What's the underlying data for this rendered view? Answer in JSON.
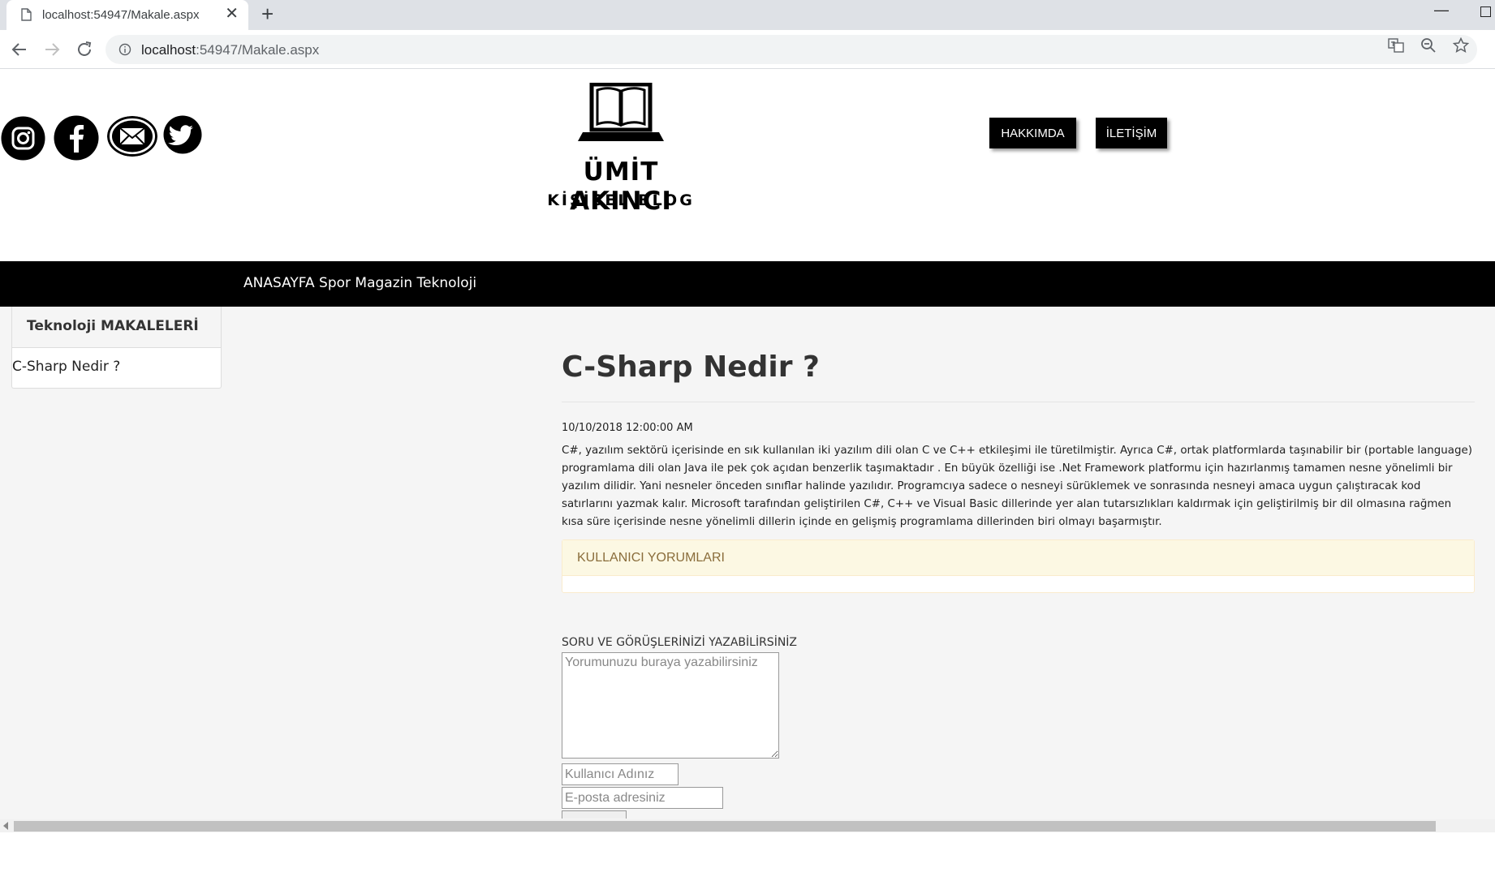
{
  "browser": {
    "tab_title": "localhost:54947/Makale.aspx",
    "tab_close": "✕",
    "new_tab": "+",
    "minimize": "—",
    "url_host": "localhost",
    "url_rest": ":54947/Makale.aspx"
  },
  "header": {
    "logo_name": "ÜMİT AKINCI",
    "logo_sub": "KİŞİSEL BLOG",
    "social_icons": [
      "instagram-icon",
      "facebook-icon",
      "mail-icon",
      "twitter-icon"
    ],
    "buttons": {
      "about": "HAKKIMDA",
      "contact": "İLETİŞİM"
    }
  },
  "nav": {
    "items": [
      "ANASAYFA",
      "Spor",
      "Magazin",
      "Teknoloji"
    ]
  },
  "sidebar": {
    "title": "Teknoloji MAKALELERİ",
    "items": [
      "C-Sharp Nedir ?"
    ]
  },
  "article": {
    "title": "C-Sharp Nedir ?",
    "date": "10/10/2018 12:00:00 AM",
    "body": "C#, yazılım sektörü içerisinde en sık kullanılan iki yazılım dili olan C ve C++ etkileşimi ile türetilmiştir. Ayrıca C#, ortak platformlarda taşınabilir bir (portable language) programlama dili olan Java ile pek çok açıdan benzerlik taşımaktadır . En büyük özelliği ise .Net Framework platformu için hazırlanmış tamamen nesne yönelimli bir yazılım dilidir. Yani nesneler önceden sınıflar halinde yazılıdır. Programcıya sadece o nesneyi sürüklemek ve sonrasında nesneyi amaca uygun çalıştıracak kod satırlarını yazmak kalır. Microsoft tarafından geliştirilen C#, C++ ve Visual Basic dillerinde yer alan tutarsızlıkları kaldırmak için geliştirilmiş bir dil olmasına rağmen kısa süre içerisinde nesne yönelimli dillerin içinde en gelişmiş programlama dillerinden biri olmayı başarmıştır."
  },
  "comments": {
    "header": "KULLANICI YORUMLARI"
  },
  "form": {
    "label": "SORU VE GÖRÜŞLERİNİZİ YAZABİLİRSİNİZ",
    "comment_placeholder": "Yorumunuzu buraya yazabilirsiniz",
    "name_placeholder": "Kullanıcı Adınız",
    "email_placeholder": "E-posta adresiniz"
  }
}
